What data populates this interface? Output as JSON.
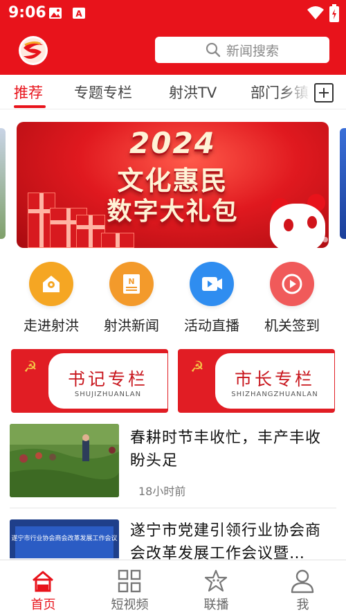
{
  "status_bar": {
    "time": "9:06"
  },
  "header": {
    "search": {
      "placeholder": "新闻搜索"
    }
  },
  "tabs": [
    {
      "label": "推荐",
      "active": true
    },
    {
      "label": "专题专栏"
    },
    {
      "label": "射洪TV"
    },
    {
      "label": "部门乡镇"
    }
  ],
  "banner": {
    "line1": "2024",
    "line2": "文化惠民",
    "line3": "数字大礼包",
    "slide_count": 5,
    "active_slide": 1
  },
  "quick_entries": [
    {
      "label": "走进射洪",
      "icon": "house-location-icon",
      "color": "#f5a623"
    },
    {
      "label": "射洪新闻",
      "icon": "newspaper-icon",
      "color": "#f39a2b"
    },
    {
      "label": "活动直播",
      "icon": "video-camera-icon",
      "color": "#2f8df0"
    },
    {
      "label": "机关签到",
      "icon": "play-circle-icon",
      "color": "#f05a5a"
    }
  ],
  "columns": [
    {
      "title": "书记专栏",
      "subtitle": "SHUJIZHUANLAN"
    },
    {
      "title": "市长专栏",
      "subtitle": "SHIZHANGZHUANLAN"
    }
  ],
  "news": [
    {
      "title": "春耕时节丰收忙，丰产丰收盼头足",
      "time": "18小时前"
    },
    {
      "title": "遂宁市党建引领行业协会商会改革发展工作会议暨…",
      "thumb_caption": "遂宁市行业协会商会改革发展工作会议"
    }
  ],
  "bottom_nav": [
    {
      "label": "首页",
      "icon": "home-icon",
      "active": true
    },
    {
      "label": "短视频",
      "icon": "grid-icon"
    },
    {
      "label": "联播",
      "icon": "star-mascot-icon"
    },
    {
      "label": "我",
      "icon": "user-icon"
    }
  ],
  "colors": {
    "brand_red": "#e8131b",
    "text": "#222222",
    "muted": "#777777"
  }
}
